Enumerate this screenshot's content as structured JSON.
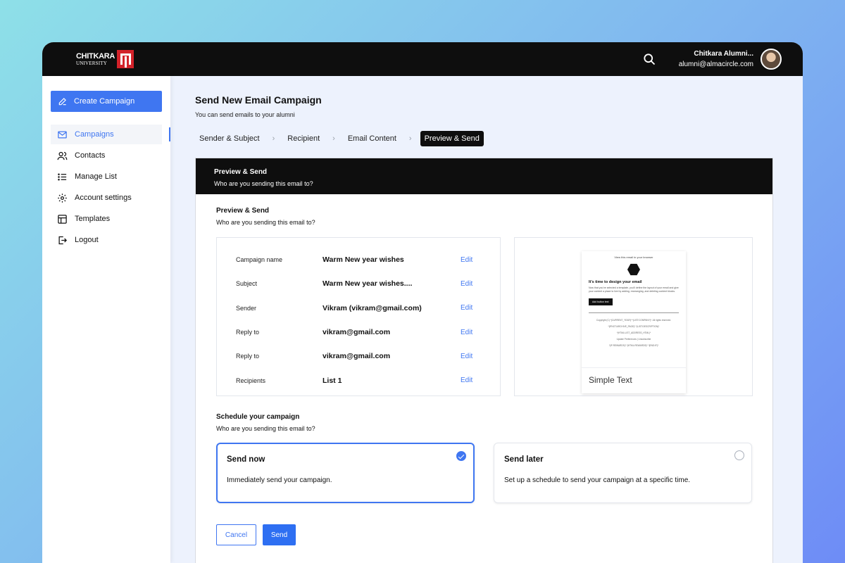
{
  "brand": {
    "line1": "CHITKARA",
    "line2": "UNIVERSITY",
    "accent": "#d3222a"
  },
  "topbar": {
    "user_name": "Chitkara Alumni...",
    "user_email": "alumni@almacircle.com",
    "search_icon": "search-icon"
  },
  "colors": {
    "primary": "#3f76f1",
    "dark": "#0e0e0e",
    "main_bg": "#edf2fd"
  },
  "sidebar": {
    "create_label": "Create Campaign",
    "items": [
      {
        "label": "Campaigns",
        "icon": "mail-icon",
        "active": true
      },
      {
        "label": "Contacts",
        "icon": "users-icon"
      },
      {
        "label": "Manage List",
        "icon": "list-icon"
      },
      {
        "label": "Account settings",
        "icon": "gear-icon"
      },
      {
        "label": "Templates",
        "icon": "template-icon"
      },
      {
        "label": "Logout",
        "icon": "logout-icon"
      }
    ]
  },
  "page": {
    "title": "Send New Email Campaign",
    "subtitle": "You can send emails to your alumni"
  },
  "steps": [
    "Sender & Subject",
    "Recipient",
    "Email Content",
    "Preview & Send"
  ],
  "active_step": "Preview & Send",
  "card": {
    "title": "Preview & Send",
    "subtitle": "Who are you sending this email to?"
  },
  "preview": {
    "title": "Preview & Send",
    "subtitle": "Who are you sending this email to?",
    "edit_label": "Edit",
    "rows": [
      {
        "label": "Campaign name",
        "value": "Warm New year wishes"
      },
      {
        "label": "Subject",
        "value": "Warm New year wishes...."
      },
      {
        "label": "Sender",
        "value": "Vikram (vikram@gmail.com)"
      },
      {
        "label": "Reply to",
        "value": "vikram@gmail.com"
      },
      {
        "label": "Reply to",
        "value": "vikram@gmail.com"
      },
      {
        "label": "Recipients",
        "value": "List 1"
      }
    ],
    "template": {
      "view_link": "View this email in your browser",
      "heading": "It's time to design your email",
      "body": "Now that you've selected a template, you'll define the layout of your email and give your content a place to live by adding, rearranging, and deleting content blocks.",
      "button": "Add button text",
      "footer": [
        "Copyright (C) *|CURRENT_YEAR|* *|LIST:COMPANY|*. All rights reserved.",
        "*|IFNOT:ARCHIVE_PAGE|* *|LIST:DESCRIPTION|*",
        "*|HTML:LIST_ADDRESS_HTML|*",
        "Update Preferences | Unsubscribe",
        "*|IF:REWARDS|* *|HTML:REWARDS|* *|END:IF|*"
      ],
      "label": "Simple Text"
    }
  },
  "schedule": {
    "title": "Schedule your campaign",
    "subtitle": "Who are you sending this email to?",
    "options": [
      {
        "title": "Send now",
        "desc": "Immediately send your campaign.",
        "selected": true
      },
      {
        "title": "Send later",
        "desc": "Set up a schedule to send your campaign at a specific time.",
        "selected": false
      }
    ]
  },
  "actions": {
    "cancel": "Cancel",
    "send": "Send"
  }
}
